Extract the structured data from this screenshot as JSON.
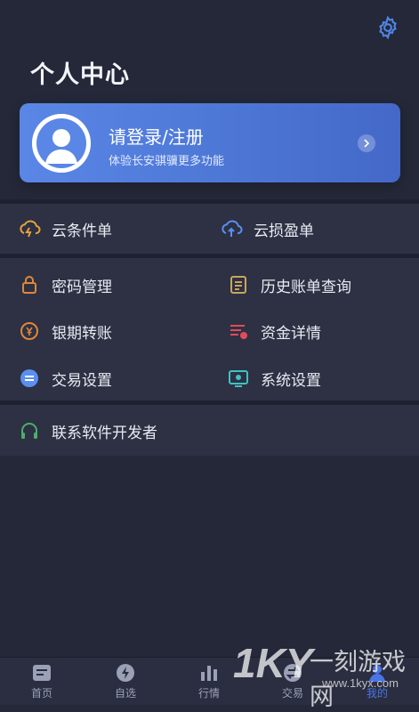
{
  "header": {
    "title": "个人中心",
    "settings_icon": "gear-icon"
  },
  "login": {
    "title": "请登录/注册",
    "subtitle": "体验长安骐骥更多功能"
  },
  "menu": {
    "cloud_conditional": "云条件单",
    "cloud_stop_profit": "云损盈单",
    "password": "密码管理",
    "history": "历史账单查询",
    "bank_transfer": "银期转账",
    "funds": "资金详情",
    "trade_settings": "交易设置",
    "system_settings": "系统设置",
    "contact_dev": "联系软件开发者"
  },
  "tabs": {
    "home": "首页",
    "watchlist": "自选",
    "market": "行情",
    "trade": "交易",
    "mine": "我的"
  },
  "watermark": {
    "brand": "1KY",
    "name": "一刻游戏网",
    "url": "www.1kyx.com"
  },
  "colors": {
    "accent": "#4b74e6",
    "background": "#242838",
    "panel": "#2d3143"
  }
}
